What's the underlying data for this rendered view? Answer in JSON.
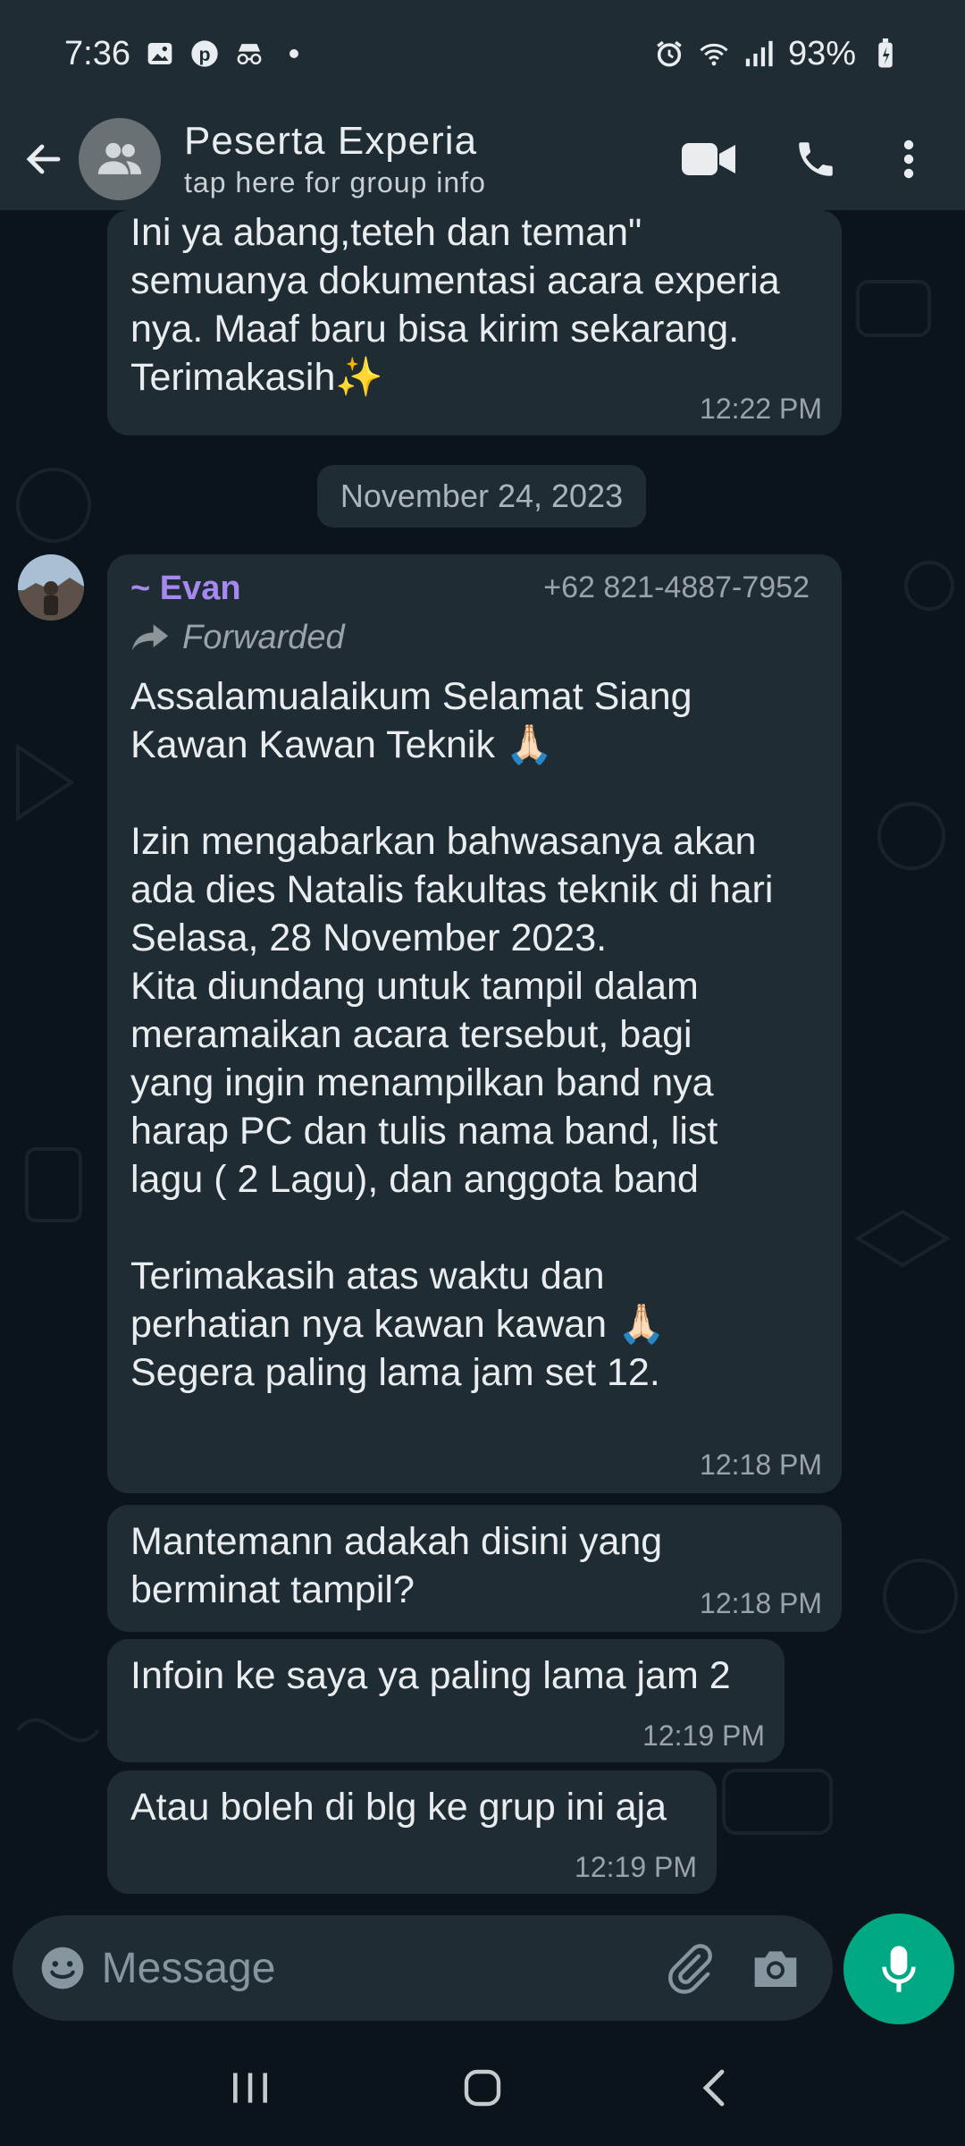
{
  "status": {
    "time": "7:36",
    "battery": "93%"
  },
  "header": {
    "title": "Peserta Experia",
    "subtitle": "tap here for group info"
  },
  "messages": {
    "m1": {
      "text": "Ini ya abang,teteh dan teman\"\nsemuanya dokumentasi acara experia\nnya. Maaf baru bisa kirim sekarang.\nTerimakasih✨",
      "time": "12:22 PM"
    },
    "date": "November 24, 2023",
    "m2": {
      "sender": "~ Evan",
      "phone": "+62 821-4887-7952",
      "forwarded": "Forwarded",
      "text": "Assalamualaikum Selamat Siang\nKawan Kawan Teknik 🙏🏻\n\nIzin mengabarkan bahwasanya akan\nada dies Natalis fakultas teknik di hari\nSelasa, 28 November 2023.\nKita diundang untuk tampil dalam\nmeramaikan acara tersebut, bagi\nyang ingin menampilkan band nya\nharap PC dan tulis nama band, list\nlagu ( 2 Lagu), dan anggota band\n\nTerimakasih atas waktu dan\nperhatian nya kawan kawan 🙏🏻\nSegera paling lama jam set 12.",
      "time": "12:18 PM"
    },
    "m3": {
      "text": "Mantemann adakah disini yang\nberminat tampil?",
      "time": "12:18 PM"
    },
    "m4": {
      "text": "Infoin ke saya ya paling lama jam 2",
      "time": "12:19 PM"
    },
    "m5": {
      "text": "Atau boleh di blg ke grup ini aja",
      "time": "12:19 PM"
    }
  },
  "input": {
    "placeholder": "Message"
  },
  "colors": {
    "accent": "#00a884",
    "sender": "#a689f0",
    "bubble": "#202c33",
    "background": "#0b141a"
  }
}
